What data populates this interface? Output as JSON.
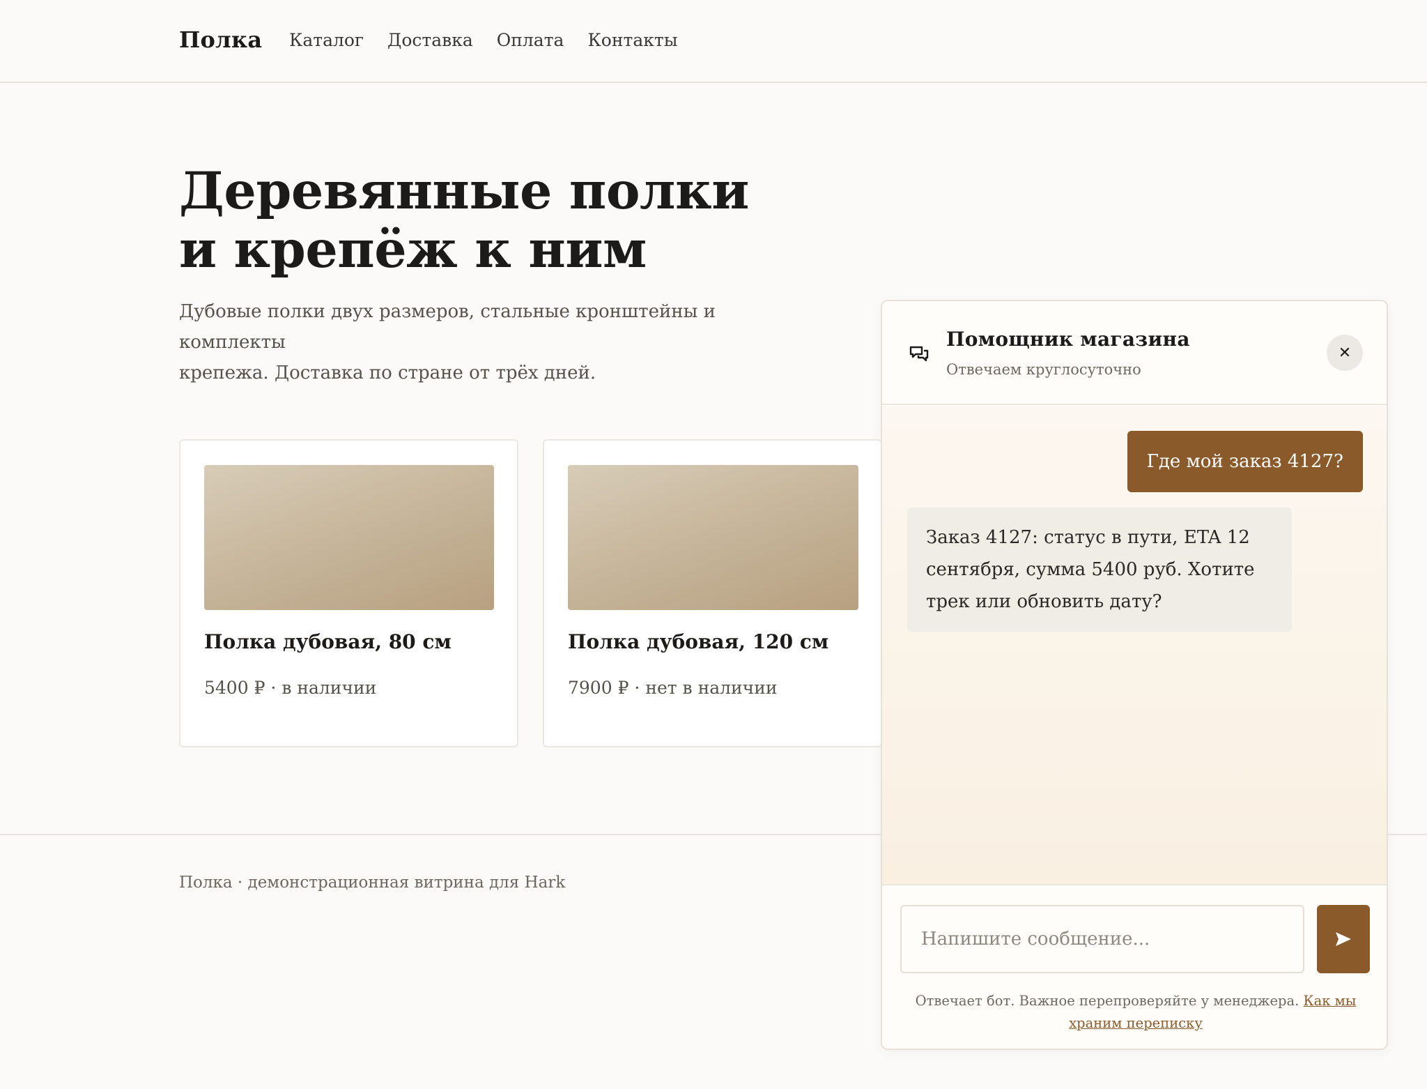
{
  "header": {
    "brand": "Полка",
    "nav": [
      "Каталог",
      "Доставка",
      "Оплата",
      "Контакты"
    ]
  },
  "hero": {
    "title_line1": "Деревянные полки",
    "title_line2": "и крепёж к ним",
    "subtitle_line1": "Дубовые полки двух размеров, стальные кронштейны и комплекты",
    "subtitle_line2": "крепежа. Доставка по стране от трёх дней."
  },
  "products": [
    {
      "name": "Полка дубовая, 80 см",
      "meta": "5400 ₽ · в наличии"
    },
    {
      "name": "Полка дубовая, 120 см",
      "meta": "7900 ₽ · нет в наличии"
    }
  ],
  "footer": {
    "text": "Полка · демонстрационная витрина для Hark"
  },
  "chat": {
    "title": "Помощник магазина",
    "status": "Отвечаем круглосуточно",
    "close_symbol": "✕",
    "user_message": "Где мой заказ 4127?",
    "bot_message_line1": "Заказ 4127: статус в пути, ETA 12",
    "bot_message_line2": "сентября, сумма 5400 руб. Хотите",
    "bot_message_line3": "трек или обновить дату?",
    "input_placeholder": "Напишите сообщение...",
    "note_text": "Отвечает бот. Важное перепроверяйте у менеджера.",
    "note_link_line1": "Как мы",
    "note_link_line2": "храним переписку",
    "icons": {
      "chat": "chat-bubbles-icon",
      "close": "close-icon",
      "send": "send-arrow-icon"
    },
    "accent_color": "#8a5a2b"
  }
}
